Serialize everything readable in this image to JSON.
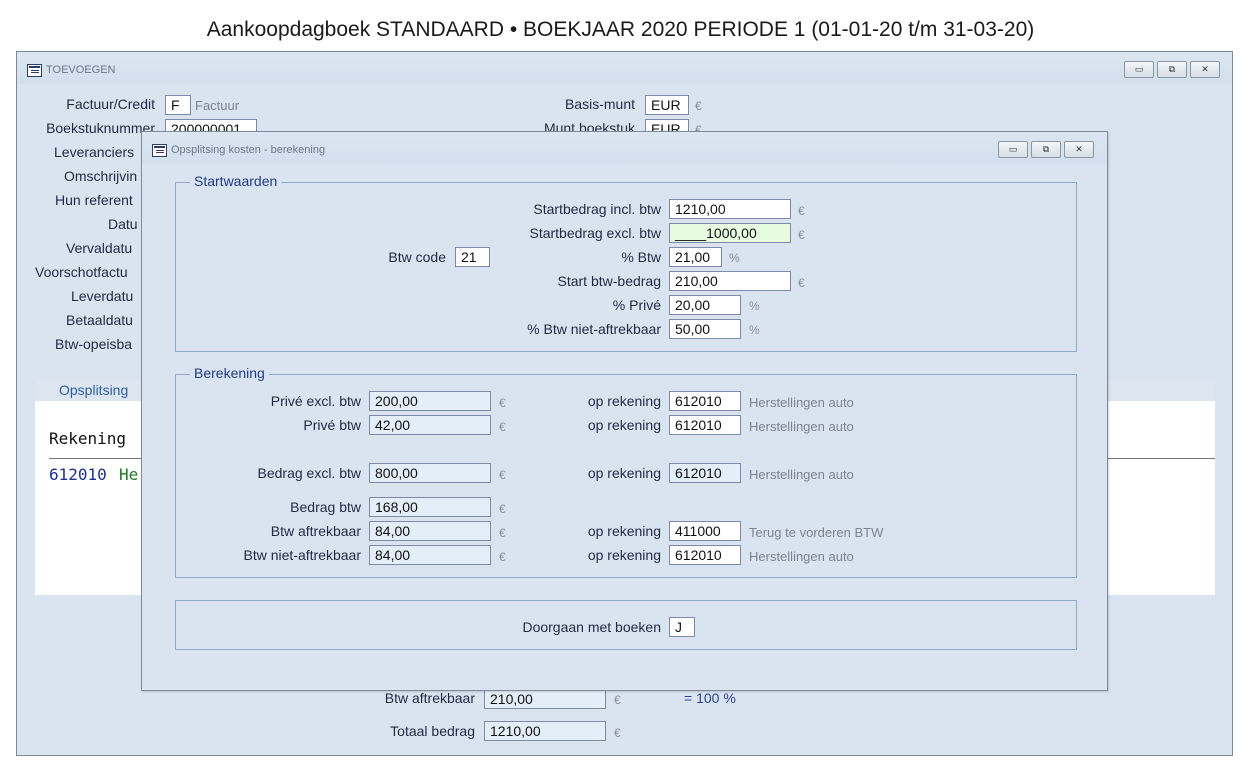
{
  "app_title": "Aankoopdagboek STANDAARD • BOEKJAAR 2020 PERIODE 1 (01-01-20 t/m 31-03-20)",
  "main_window": {
    "title": "TOEVOEGEN",
    "controls": {
      "minimize": "▭",
      "restore": "⧉",
      "close": "✕"
    },
    "fields": {
      "factuur_credit": {
        "label": "Factuur/Credit",
        "value": "F",
        "hint": "Factuur"
      },
      "boekstuknummer": {
        "label": "Boekstuknummer",
        "value": "200000001"
      },
      "leveranciers": {
        "label": "Leveranciers"
      },
      "omschrijving": {
        "label": "Omschrijvin"
      },
      "hun_referentie": {
        "label": "Hun referent"
      },
      "datum": {
        "label": "Datu"
      },
      "vervaldatum": {
        "label": "Vervaldatu"
      },
      "voorschotfactuur": {
        "label": "Voorschotfactu"
      },
      "leverdatum": {
        "label": "Leverdatu"
      },
      "betaaldatum": {
        "label": "Betaaldatu"
      },
      "btw_opeisbaar": {
        "label": "Btw-opeisba"
      },
      "basis_munt": {
        "label": "Basis-munt",
        "value": "EUR",
        "unit": "€"
      },
      "munt_boekstuk": {
        "label": "Munt boekstuk",
        "value": "EUR",
        "unit": "€"
      }
    },
    "tab_label": "Opsplitsing",
    "list": {
      "header": "Rekening",
      "rows": [
        {
          "code": "612010",
          "name": "Her"
        }
      ]
    },
    "totals": {
      "btw_aftrekbaar": {
        "label": "Btw aftrekbaar",
        "value": "210,00",
        "unit": "€",
        "note": "= 100 %"
      },
      "totaal_bedrag": {
        "label": "Totaal bedrag",
        "value": "1210,00",
        "unit": "€"
      }
    }
  },
  "dialog": {
    "title": "Opsplitsing kosten - berekening",
    "controls": {
      "minimize": "▭",
      "restore": "⧉",
      "close": "✕"
    },
    "startwaarden": {
      "title": "Startwaarden",
      "startbedrag_incl": {
        "label": "Startbedrag incl. btw",
        "value": "1210,00",
        "unit": "€"
      },
      "startbedrag_excl": {
        "label": "Startbedrag excl. btw",
        "value": "____1000,00",
        "unit": "€"
      },
      "btw_code": {
        "label": "Btw code",
        "value": "21"
      },
      "pct_btw": {
        "label": "% Btw",
        "value": "21,00",
        "unit": "%"
      },
      "start_btw_bedrag": {
        "label": "Start btw-bedrag",
        "value": "210,00",
        "unit": "€"
      },
      "pct_prive": {
        "label": "% Privé",
        "value": "20,00",
        "unit": "%"
      },
      "pct_niet_aftrekbaar": {
        "label": "% Btw niet-aftrekbaar",
        "value": "50,00",
        "unit": "%"
      }
    },
    "berekening": {
      "title": "Berekening",
      "op_rekening_label": "op rekening",
      "rows": [
        {
          "label": "Privé excl. btw",
          "value": "200,00",
          "unit": "€",
          "account": "612010",
          "account_name": "Herstellingen auto"
        },
        {
          "label": "Privé btw",
          "value": "42,00",
          "unit": "€",
          "account": "612010",
          "account_name": "Herstellingen auto"
        },
        {
          "label": "Bedrag excl. btw",
          "value": "800,00",
          "unit": "€",
          "account": "612010",
          "account_name": "Herstellingen auto"
        },
        {
          "label": "Bedrag btw",
          "value": "168,00",
          "unit": "€"
        },
        {
          "label": "Btw aftrekbaar",
          "value": "84,00",
          "unit": "€",
          "account": "411000",
          "account_name": "Terug te vorderen BTW"
        },
        {
          "label": "Btw niet-aftrekbaar",
          "value": "84,00",
          "unit": "€",
          "account": "612010",
          "account_name": "Herstellingen auto"
        }
      ]
    },
    "doorgaan": {
      "label": "Doorgaan met boeken",
      "value": "J"
    }
  }
}
